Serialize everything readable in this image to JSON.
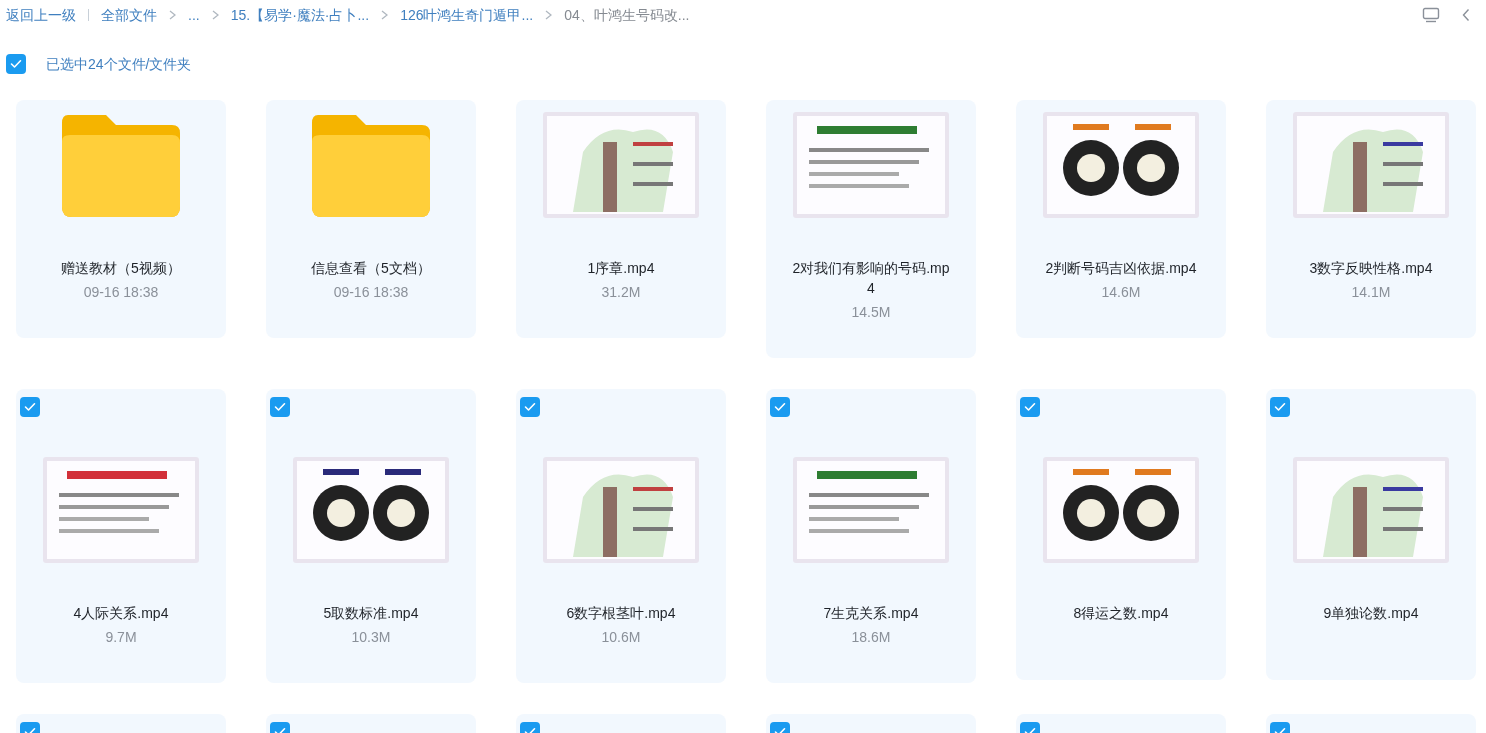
{
  "breadcrumb": {
    "back": "返回上一级",
    "items": [
      {
        "label": "全部文件",
        "current": false
      },
      {
        "label": "...",
        "current": false
      },
      {
        "label": "15.【易学·魔法·占卜...",
        "current": false
      },
      {
        "label": "126叶鸿生奇门遁甲...",
        "current": false
      },
      {
        "label": "04、叶鸿生号码改...",
        "current": true
      }
    ]
  },
  "toolbar": {
    "select_all": {
      "checked": true
    },
    "selection_text": "已选中24个文件/文件夹"
  },
  "files": [
    {
      "kind": "folder",
      "name": "赠送教材（5视频）",
      "meta": "09-16 18:38"
    },
    {
      "kind": "folder",
      "name": "信息查看（5文档）",
      "meta": "09-16 18:38"
    },
    {
      "kind": "video",
      "name": "1序章.mp4",
      "meta": "31.2M"
    },
    {
      "kind": "video",
      "name": "2对我们有影响的号码.mp4",
      "meta": "14.5M"
    },
    {
      "kind": "video",
      "name": "2判断号码吉凶依据.mp4",
      "meta": "14.6M"
    },
    {
      "kind": "video",
      "name": "3数字反映性格.mp4",
      "meta": "14.1M"
    },
    {
      "kind": "video",
      "name": "4人际关系.mp4",
      "meta": "9.7M",
      "selected": true
    },
    {
      "kind": "video",
      "name": "5取数标准.mp4",
      "meta": "10.3M",
      "selected": true
    },
    {
      "kind": "video",
      "name": "6数字根茎叶.mp4",
      "meta": "10.6M",
      "selected": true
    },
    {
      "kind": "video",
      "name": "7生克关系.mp4",
      "meta": "18.6M",
      "selected": true
    },
    {
      "kind": "video",
      "name": "8得运之数.mp4",
      "selected": true
    },
    {
      "kind": "video",
      "name": "9单独论数.mp4",
      "selected": true
    },
    {
      "selected": true
    },
    {
      "selected": true
    },
    {
      "selected": true
    },
    {
      "selected": true
    },
    {
      "selected": true
    },
    {
      "selected": true
    }
  ]
}
